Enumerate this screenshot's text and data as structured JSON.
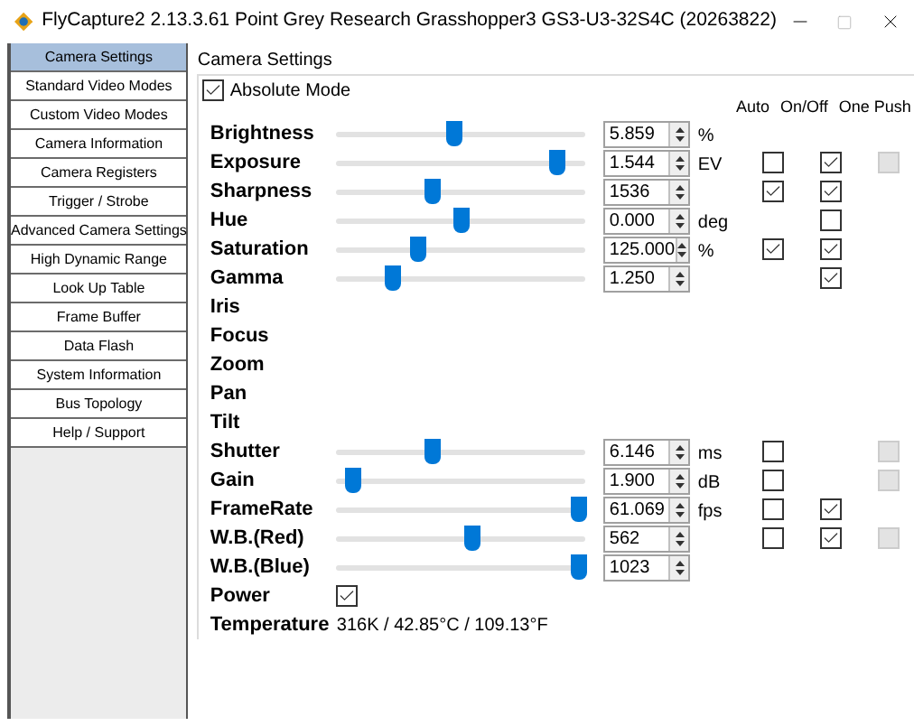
{
  "window": {
    "title": "FlyCapture2 2.13.3.61  Point Grey Research Grasshopper3 GS3-U3-32S4C (20263822)"
  },
  "sidebar": {
    "items": [
      {
        "label": "Camera Settings",
        "selected": true
      },
      {
        "label": "Standard Video Modes",
        "selected": false
      },
      {
        "label": "Custom Video Modes",
        "selected": false
      },
      {
        "label": "Camera Information",
        "selected": false
      },
      {
        "label": "Camera Registers",
        "selected": false
      },
      {
        "label": "Trigger / Strobe",
        "selected": false
      },
      {
        "label": "Advanced Camera Settings",
        "selected": false
      },
      {
        "label": "High Dynamic Range",
        "selected": false
      },
      {
        "label": "Look Up Table",
        "selected": false
      },
      {
        "label": "Frame Buffer",
        "selected": false
      },
      {
        "label": "Data Flash",
        "selected": false
      },
      {
        "label": "System Information",
        "selected": false
      },
      {
        "label": "Bus Topology",
        "selected": false
      },
      {
        "label": "Help / Support",
        "selected": false
      }
    ]
  },
  "panel": {
    "title": "Camera Settings",
    "absolute_mode": {
      "label": "Absolute Mode",
      "checked": true
    },
    "columns": [
      "Auto",
      "On/Off",
      "One Push"
    ],
    "properties": [
      {
        "kind": "slider",
        "name": "Brightness",
        "level": 0.47,
        "value": "5.859",
        "unit": "%"
      },
      {
        "kind": "slider",
        "name": "Exposure",
        "level": 0.88,
        "value": "1.544",
        "unit": "EV",
        "auto": {
          "checked": false
        },
        "on_off": {
          "checked": true
        },
        "one_push": {
          "checked": false,
          "disabled": true
        }
      },
      {
        "kind": "slider",
        "name": "Sharpness",
        "level": 0.38,
        "value": "1536",
        "auto": {
          "checked": true
        },
        "on_off": {
          "checked": true
        }
      },
      {
        "kind": "slider",
        "name": "Hue",
        "level": 0.5,
        "value": "0.000",
        "unit": "deg",
        "on_off": {
          "checked": false
        }
      },
      {
        "kind": "slider",
        "name": "Saturation",
        "level": 0.32,
        "value": "125.000",
        "unit": "%",
        "auto": {
          "checked": true
        },
        "on_off": {
          "checked": true
        }
      },
      {
        "kind": "slider",
        "name": "Gamma",
        "level": 0.22,
        "value": "1.250",
        "on_off": {
          "checked": true
        }
      },
      {
        "kind": "label",
        "name": "Iris"
      },
      {
        "kind": "label",
        "name": "Focus"
      },
      {
        "kind": "label",
        "name": "Zoom"
      },
      {
        "kind": "label",
        "name": "Pan"
      },
      {
        "kind": "label",
        "name": "Tilt"
      },
      {
        "kind": "slider",
        "name": "Shutter",
        "level": 0.38,
        "value": "6.146",
        "unit": "ms",
        "auto": {
          "checked": false
        },
        "one_push": {
          "checked": false,
          "disabled": true
        }
      },
      {
        "kind": "slider",
        "name": "Gain",
        "level": 0.06,
        "value": "1.900",
        "unit": "dB",
        "auto": {
          "checked": false
        },
        "one_push": {
          "checked": false,
          "disabled": true
        }
      },
      {
        "kind": "slider",
        "name": "FrameRate",
        "level": 0.97,
        "value": "61.069",
        "unit": "fps",
        "auto": {
          "checked": false
        },
        "on_off": {
          "checked": true
        }
      },
      {
        "kind": "slider",
        "name": "W.B.(Red)",
        "level": 0.54,
        "value": "562",
        "auto": {
          "checked": false
        },
        "on_off": {
          "checked": true
        },
        "one_push": {
          "checked": false,
          "disabled": true
        }
      },
      {
        "kind": "slider",
        "name": "W.B.(Blue)",
        "level": 0.97,
        "value": "1023"
      },
      {
        "kind": "checkbox",
        "name": "Power",
        "checked": true
      },
      {
        "kind": "reading",
        "name": "Temperature",
        "value": "316K / 42.85°C / 109.13°F"
      }
    ]
  }
}
